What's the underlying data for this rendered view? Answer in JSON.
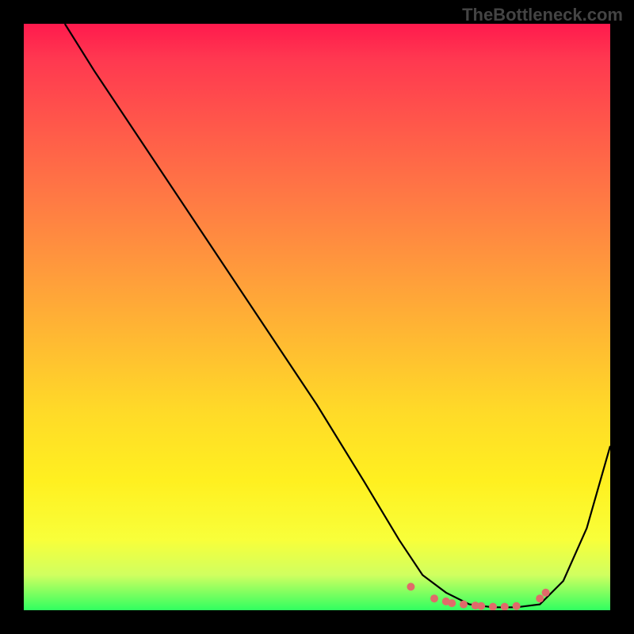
{
  "watermark": "TheBottleneck.com",
  "chart_data": {
    "type": "line",
    "title": "",
    "xlabel": "",
    "ylabel": "",
    "xlim": [
      0,
      100
    ],
    "ylim": [
      0,
      100
    ],
    "series": [
      {
        "name": "curve",
        "color": "#000000",
        "x": [
          7,
          12,
          20,
          30,
          40,
          50,
          58,
          64,
          68,
          72,
          76,
          80,
          84,
          88,
          92,
          96,
          100
        ],
        "y": [
          100,
          92,
          80,
          65,
          50,
          35,
          22,
          12,
          6,
          3,
          1,
          0.5,
          0.5,
          1,
          5,
          14,
          28
        ]
      }
    ],
    "dots": {
      "name": "highlight",
      "color": "#e06a6a",
      "x": [
        66,
        70,
        72,
        73,
        75,
        77,
        78,
        80,
        82,
        84,
        88,
        89
      ],
      "y": [
        4,
        2,
        1.5,
        1.2,
        1,
        0.8,
        0.7,
        0.6,
        0.6,
        0.7,
        2,
        3
      ]
    },
    "background_gradient": {
      "top": "#ff1a4d",
      "mid_upper": "#ff9a3c",
      "mid_lower": "#ffda28",
      "bottom": "#30ff60"
    }
  }
}
